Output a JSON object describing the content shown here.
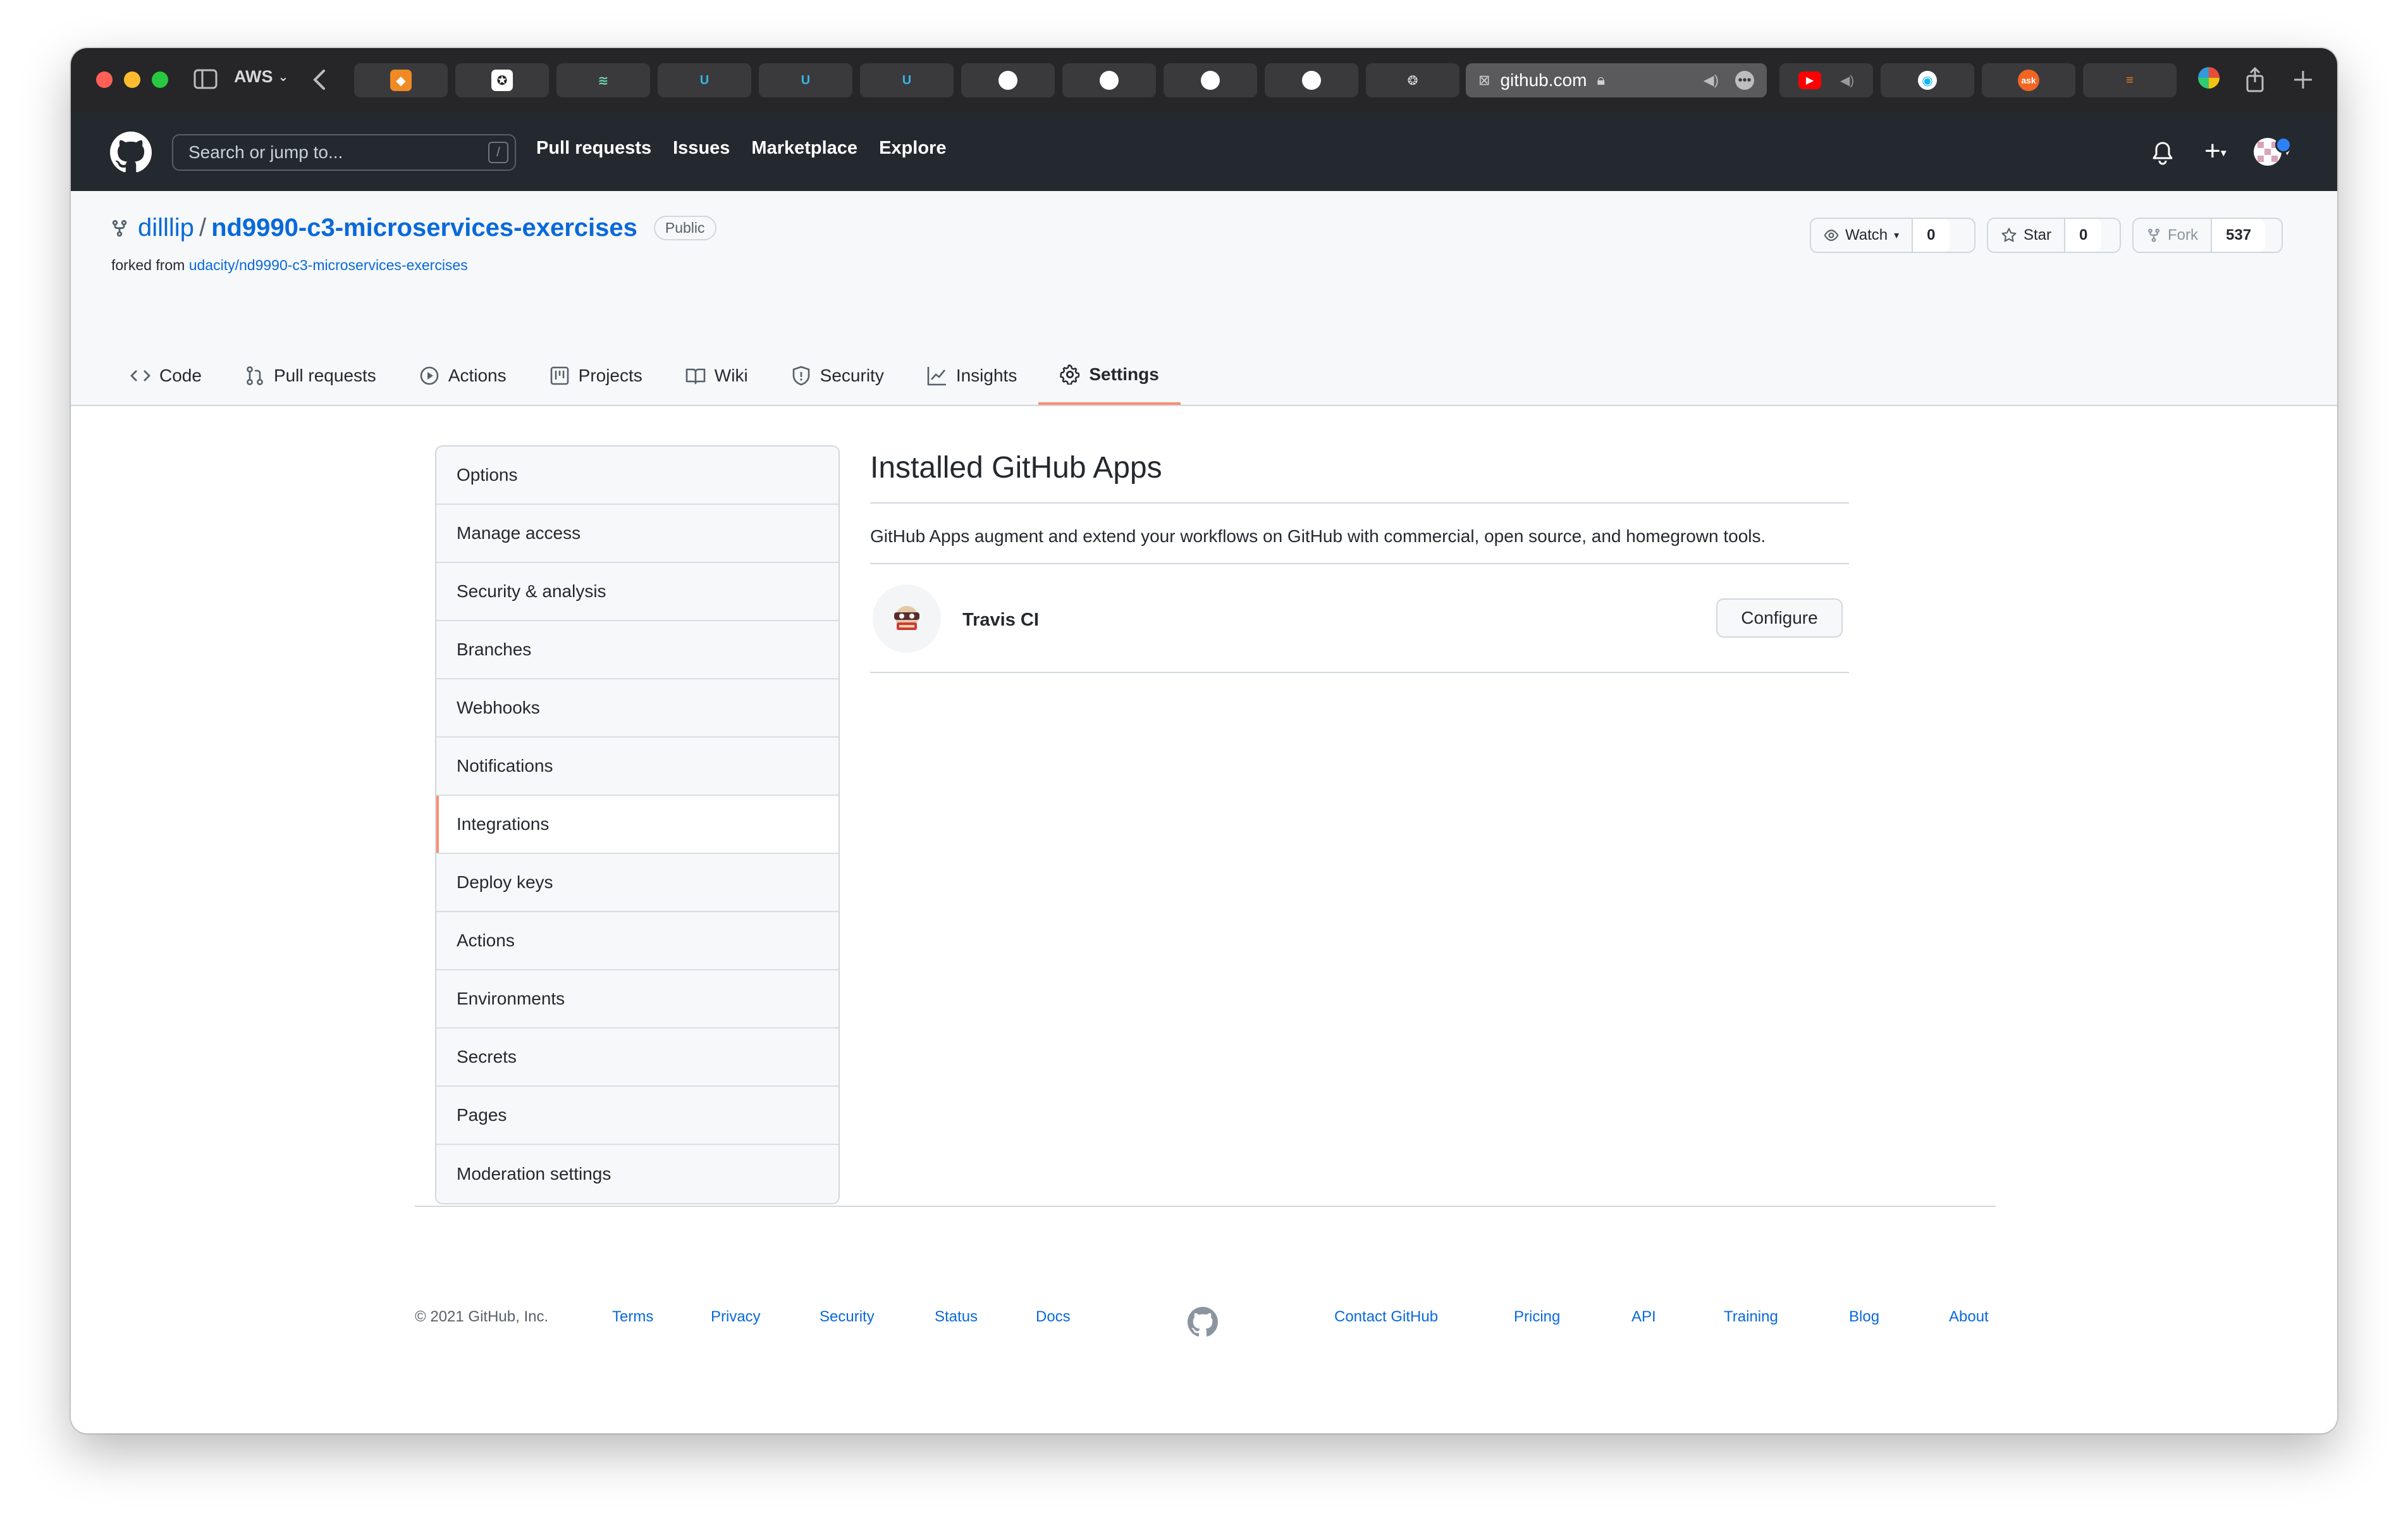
{
  "browser": {
    "tab_group": "AWS",
    "url": "github.com"
  },
  "gh_header": {
    "search_placeholder": "Search or jump to...",
    "search_shortcut": "/",
    "nav": [
      "Pull requests",
      "Issues",
      "Marketplace",
      "Explore"
    ]
  },
  "repo": {
    "owner": "dilllip",
    "separator": "/",
    "name": "nd9990-c3-microservices-exercises",
    "visibility": "Public",
    "forked_prefix": "forked from",
    "forked_from": "udacity/nd9990-c3-microservices-exercises",
    "watch_label": "Watch",
    "watch_count": "0",
    "star_label": "Star",
    "star_count": "0",
    "fork_label": "Fork",
    "fork_count": "537"
  },
  "repo_tabs": [
    "Code",
    "Pull requests",
    "Actions",
    "Projects",
    "Wiki",
    "Security",
    "Insights",
    "Settings"
  ],
  "sidebar": {
    "active": "Integrations",
    "items": [
      "Options",
      "Manage access",
      "Security & analysis",
      "Branches",
      "Webhooks",
      "Notifications",
      "Integrations",
      "Deploy keys",
      "Actions",
      "Environments",
      "Secrets",
      "Pages",
      "Moderation settings"
    ]
  },
  "main": {
    "title": "Installed GitHub Apps",
    "description": "GitHub Apps augment and extend your workflows on GitHub with commercial, open source, and homegrown tools.",
    "app_name": "Travis CI",
    "configure_label": "Configure"
  },
  "footer": {
    "copyright": "© 2021 GitHub, Inc.",
    "links_left": [
      "Terms",
      "Privacy",
      "Security",
      "Status",
      "Docs"
    ],
    "links_right": [
      "Contact GitHub",
      "Pricing",
      "API",
      "Training",
      "Blog",
      "About"
    ]
  },
  "colors": {
    "header_bg": "#24292f",
    "link": "#0969da",
    "active_tab_underline": "#fd8c73"
  }
}
